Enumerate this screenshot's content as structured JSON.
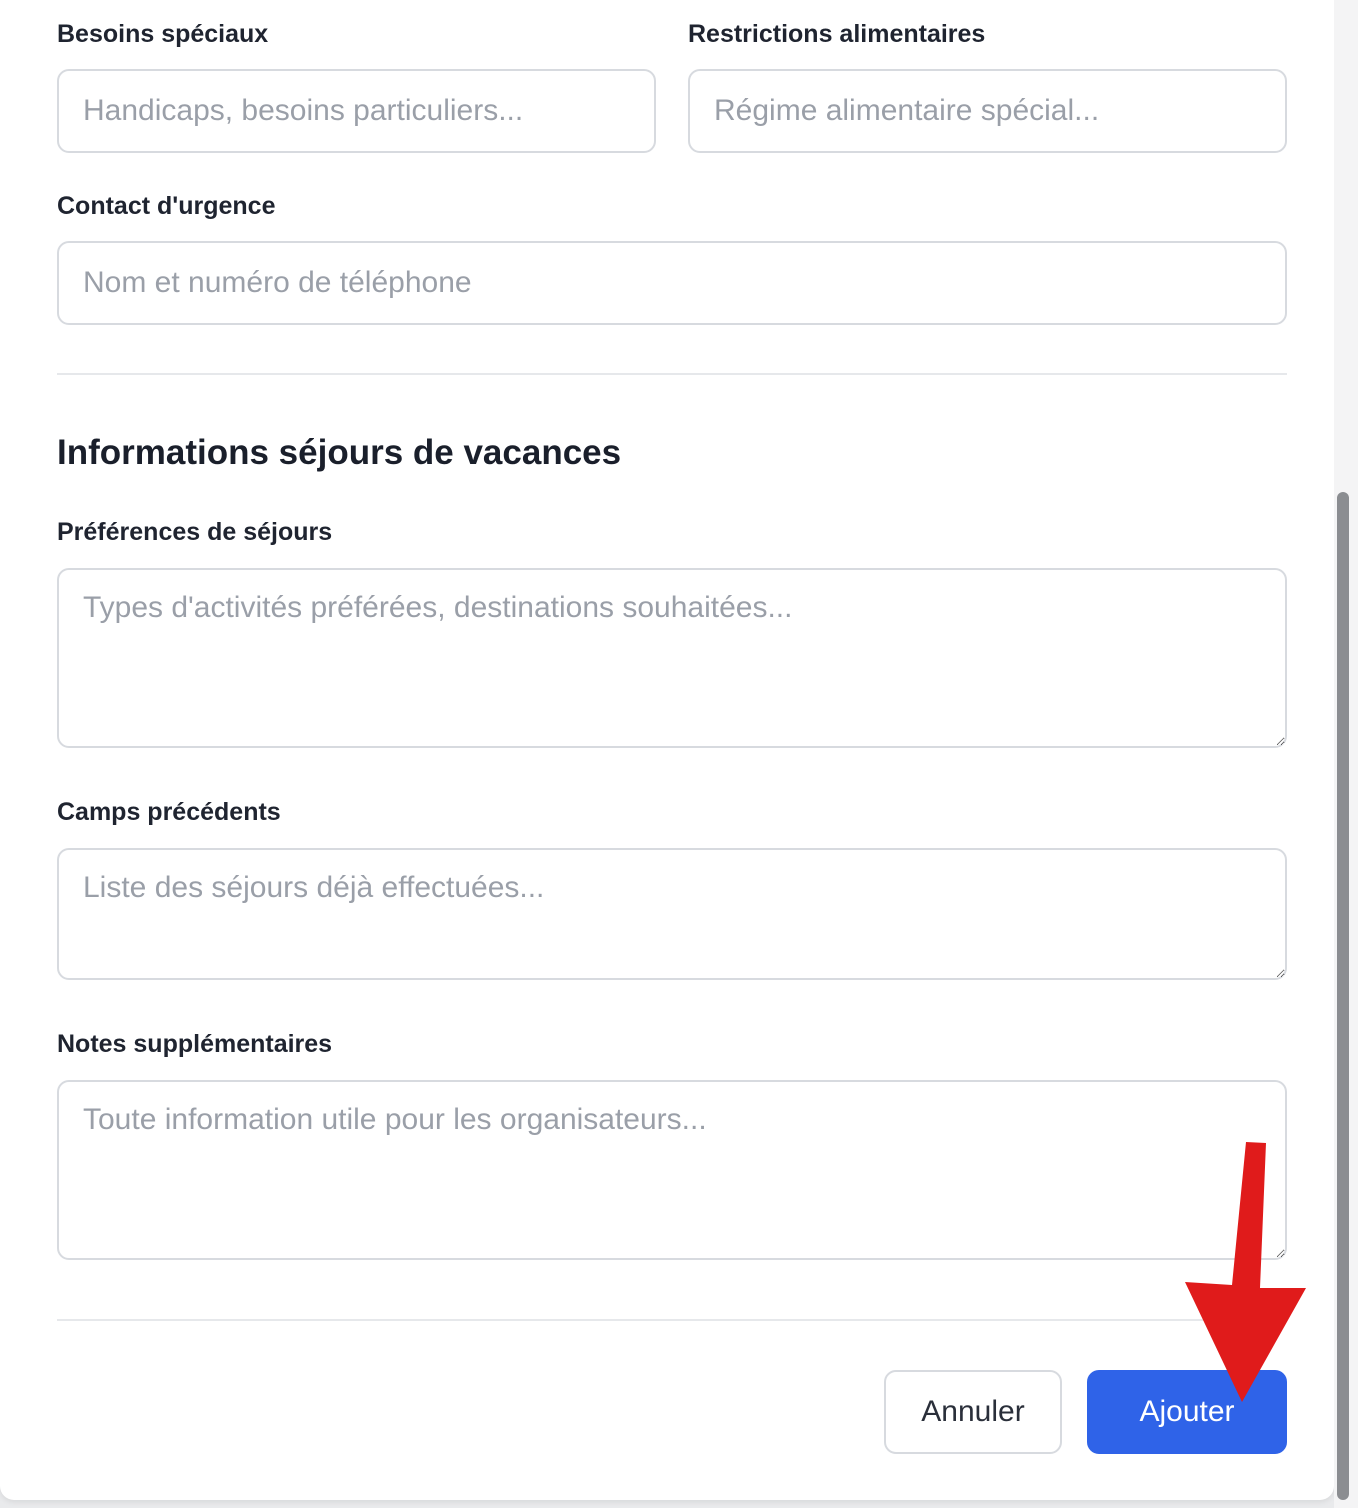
{
  "form": {
    "special_needs": {
      "label": "Besoins spéciaux",
      "placeholder": "Handicaps, besoins particuliers..."
    },
    "dietary_restrictions": {
      "label": "Restrictions alimentaires",
      "placeholder": "Régime alimentaire spécial..."
    },
    "emergency_contact": {
      "label": "Contact d'urgence",
      "placeholder": "Nom et numéro de téléphone"
    },
    "vacation_section": {
      "title": "Informations séjours de vacances"
    },
    "stay_preferences": {
      "label": "Préférences de séjours",
      "placeholder": "Types d'activités préférées, destinations souhaitées..."
    },
    "previous_camps": {
      "label": "Camps précédents",
      "placeholder": "Liste des séjours déjà effectuées..."
    },
    "additional_notes": {
      "label": "Notes supplémentaires",
      "placeholder": "Toute information utile pour les organisateurs..."
    }
  },
  "actions": {
    "cancel_label": "Annuler",
    "submit_label": "Ajouter"
  },
  "colors": {
    "primary": "#2f63e8",
    "annotation_arrow": "#e01b1b"
  }
}
